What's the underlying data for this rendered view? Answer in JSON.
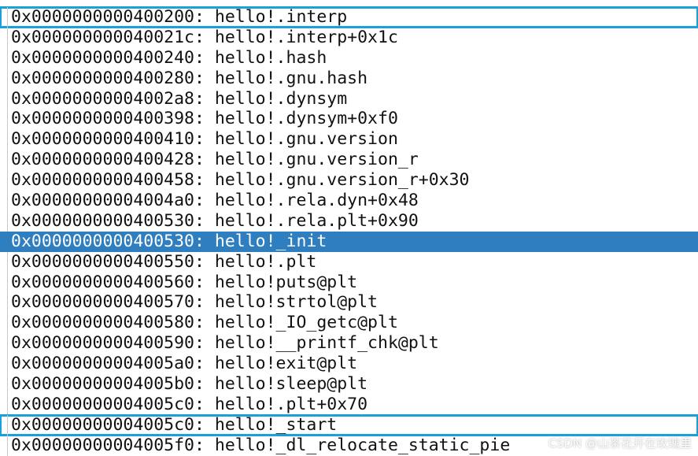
{
  "symbol_list": {
    "separator": ": ",
    "rows": [
      {
        "address": "0x0000000000400200",
        "symbol": "hello!.interp",
        "selected": false,
        "boxed": true
      },
      {
        "address": "0x000000000040021c",
        "symbol": "hello!.interp+0x1c",
        "selected": false,
        "boxed": false
      },
      {
        "address": "0x0000000000400240",
        "symbol": "hello!.hash",
        "selected": false,
        "boxed": false
      },
      {
        "address": "0x0000000000400280",
        "symbol": "hello!.gnu.hash",
        "selected": false,
        "boxed": false
      },
      {
        "address": "0x00000000004002a8",
        "symbol": "hello!.dynsym",
        "selected": false,
        "boxed": false
      },
      {
        "address": "0x0000000000400398",
        "symbol": "hello!.dynsym+0xf0",
        "selected": false,
        "boxed": false
      },
      {
        "address": "0x0000000000400410",
        "symbol": "hello!.gnu.version",
        "selected": false,
        "boxed": false
      },
      {
        "address": "0x0000000000400428",
        "symbol": "hello!.gnu.version_r",
        "selected": false,
        "boxed": false
      },
      {
        "address": "0x0000000000400458",
        "symbol": "hello!.gnu.version_r+0x30",
        "selected": false,
        "boxed": false
      },
      {
        "address": "0x00000000004004a0",
        "symbol": "hello!.rela.dyn+0x48",
        "selected": false,
        "boxed": false
      },
      {
        "address": "0x0000000000400530",
        "symbol": "hello!.rela.plt+0x90",
        "selected": false,
        "boxed": false
      },
      {
        "address": "0x0000000000400530",
        "symbol": "hello!_init",
        "selected": true,
        "boxed": false
      },
      {
        "address": "0x0000000000400550",
        "symbol": "hello!.plt",
        "selected": false,
        "boxed": false
      },
      {
        "address": "0x0000000000400560",
        "symbol": "hello!puts@plt",
        "selected": false,
        "boxed": false
      },
      {
        "address": "0x0000000000400570",
        "symbol": "hello!strtol@plt",
        "selected": false,
        "boxed": false
      },
      {
        "address": "0x0000000000400580",
        "symbol": "hello!_IO_getc@plt",
        "selected": false,
        "boxed": false
      },
      {
        "address": "0x0000000000400590",
        "symbol": "hello!__printf_chk@plt",
        "selected": false,
        "boxed": false
      },
      {
        "address": "0x00000000004005a0",
        "symbol": "hello!exit@plt",
        "selected": false,
        "boxed": false
      },
      {
        "address": "0x00000000004005b0",
        "symbol": "hello!sleep@plt",
        "selected": false,
        "boxed": false
      },
      {
        "address": "0x00000000004005c0",
        "symbol": "hello!.plt+0x70",
        "selected": false,
        "boxed": false
      },
      {
        "address": "0x00000000004005c0",
        "symbol": "hello!_start",
        "selected": false,
        "boxed": true
      },
      {
        "address": "0x00000000004005f0",
        "symbol": "hello!_dl_relocate_static_pie",
        "selected": false,
        "boxed": false
      }
    ]
  },
  "watermark": "CSDN @山茶花开在玫瑰里",
  "colors": {
    "selection": "#2f7fc0",
    "highlight_box": "#18a2dc",
    "text": "#111111",
    "gutter": "#c8c8c8"
  }
}
